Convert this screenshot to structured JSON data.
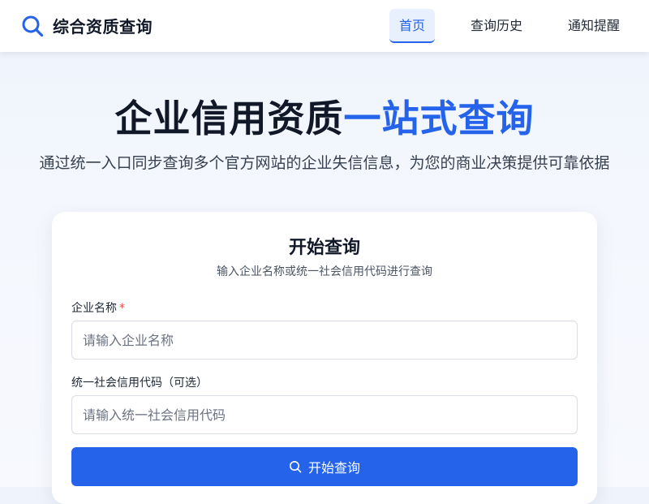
{
  "navbar": {
    "brand_icon": "search-icon",
    "brand_title": "综合资质查询",
    "nav_items": [
      {
        "label": "首页",
        "active": true
      },
      {
        "label": "查询历史",
        "active": false
      },
      {
        "label": "通知提醒",
        "active": false
      }
    ]
  },
  "hero": {
    "title_main": "企业信用资质",
    "title_accent": "一站式查询",
    "subtitle": "通过统一入口同步查询多个官方网站的企业失信信息，为您的商业决策提供可靠依据"
  },
  "query_card": {
    "title": "开始查询",
    "subtitle": "输入企业名称或统一社会信用代码进行查询",
    "company_name": {
      "label": "企业名称",
      "required_mark": "*",
      "placeholder": "请输入企业名称",
      "value": ""
    },
    "credit_code": {
      "label": "统一社会信用代码（可选）",
      "placeholder": "请输入统一社会信用代码",
      "value": ""
    },
    "submit": {
      "icon": "search-icon",
      "label": "开始查询"
    }
  },
  "colors": {
    "accent": "#2563eb",
    "required": "#ef4444",
    "nav_active_bg": "#e8effd",
    "heading": "#111827"
  }
}
